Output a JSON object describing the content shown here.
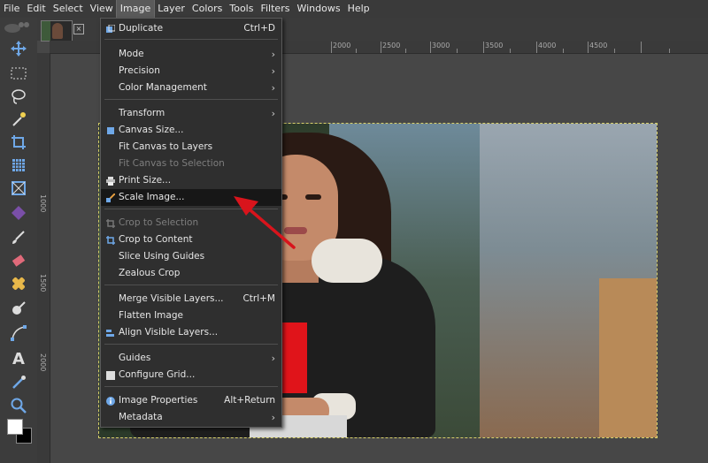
{
  "menubar": [
    "File",
    "Edit",
    "Select",
    "View",
    "Image",
    "Layer",
    "Colors",
    "Tools",
    "Filters",
    "Windows",
    "Help"
  ],
  "active_menu": "Image",
  "ruler": {
    "top": [
      "2000",
      "2500",
      "3000",
      "3500",
      "4000",
      "4500"
    ],
    "left": [
      "1000",
      "1500",
      "2000"
    ]
  },
  "image_menu": {
    "duplicate": {
      "label": "Duplicate",
      "shortcut": "Ctrl+D"
    },
    "mode": "Mode",
    "precision": "Precision",
    "color_management": "Color Management",
    "transform": "Transform",
    "canvas_size": "Canvas Size...",
    "fit_canvas_layers": "Fit Canvas to Layers",
    "fit_canvas_selection": "Fit Canvas to Selection",
    "print_size": "Print Size...",
    "scale_image": "Scale Image...",
    "crop_selection": "Crop to Selection",
    "crop_content": "Crop to Content",
    "slice_guides": "Slice Using Guides",
    "zealous_crop": "Zealous Crop",
    "merge_visible": {
      "label": "Merge Visible Layers...",
      "shortcut": "Ctrl+M"
    },
    "flatten": "Flatten Image",
    "align_visible": "Align Visible Layers...",
    "guides": "Guides",
    "configure_grid": "Configure Grid...",
    "image_properties": {
      "label": "Image Properties",
      "shortcut": "Alt+Return"
    },
    "metadata": "Metadata"
  },
  "colors": {
    "accent_arrow": "#d8141c",
    "menu_bg": "#2f2f2f",
    "hover_bg": "#171717",
    "canvas_bg": "#474747"
  }
}
